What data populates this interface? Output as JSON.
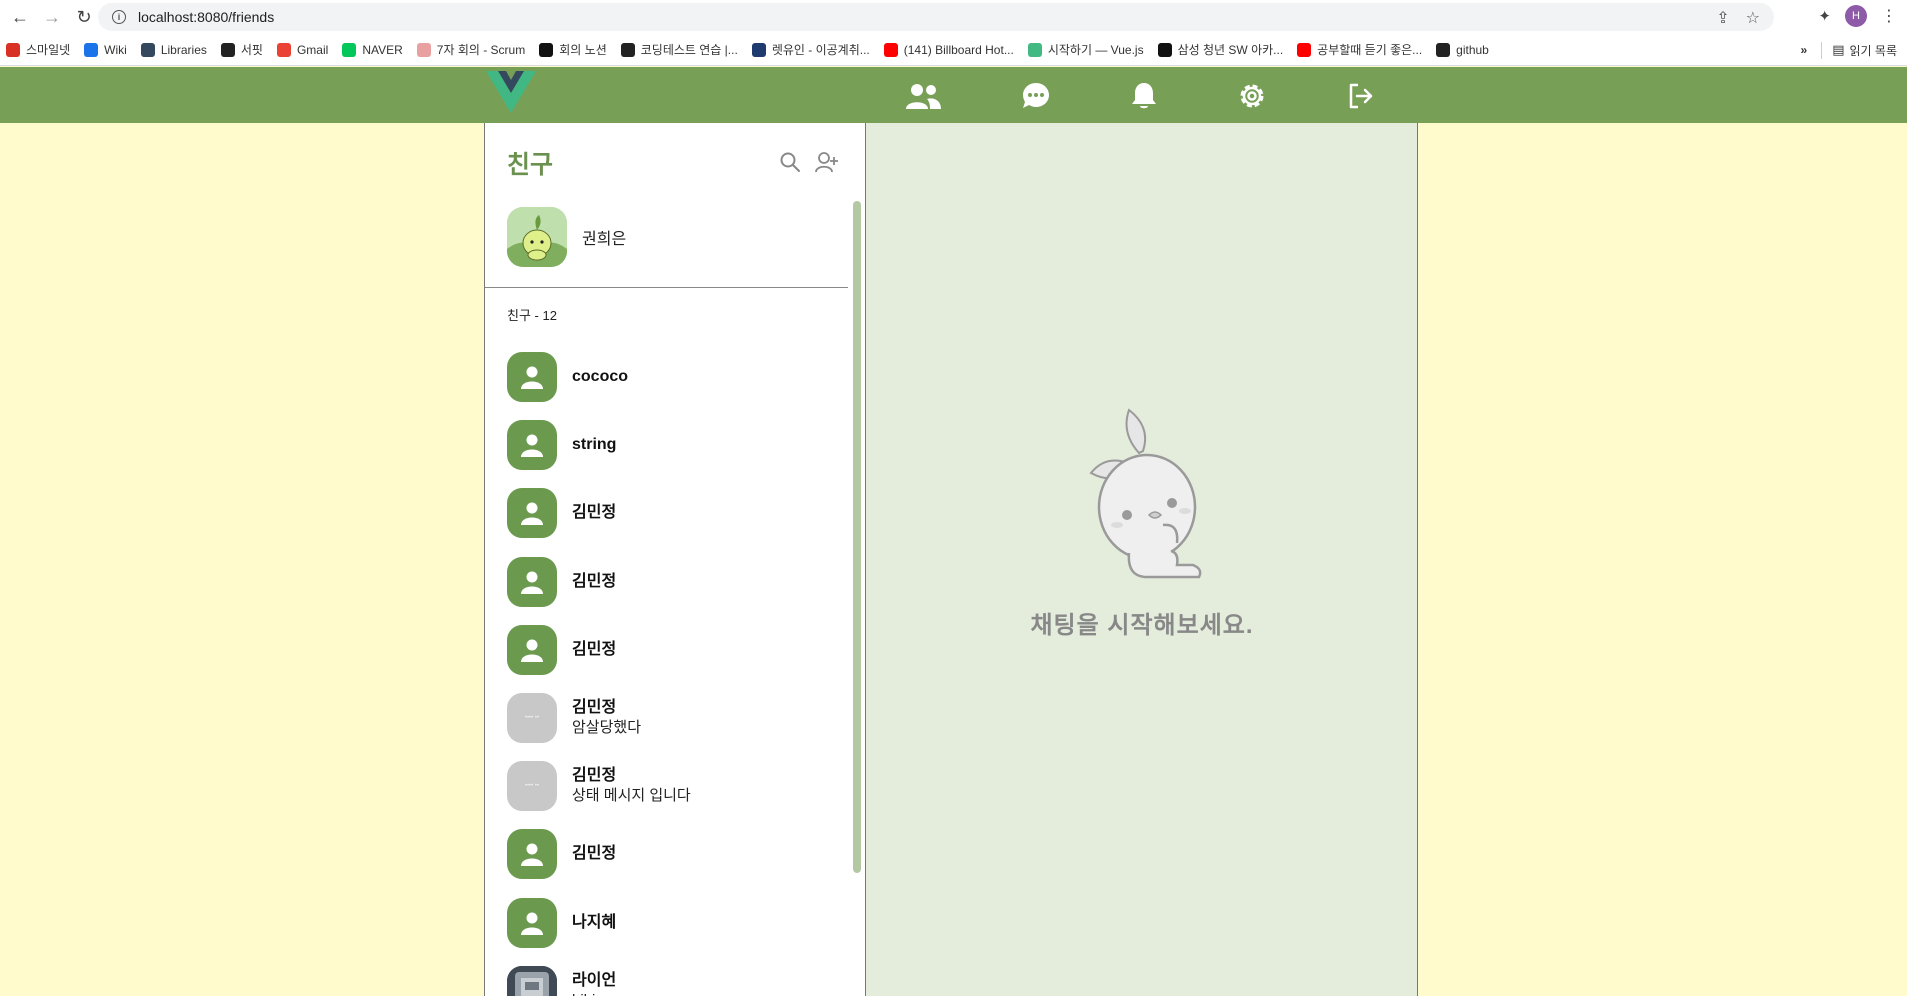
{
  "browser": {
    "url": "localhost:8080/friends",
    "profile_initial": "H",
    "bookmarks": [
      {
        "label": "스마일넷",
        "color": "#d93025"
      },
      {
        "label": "Wiki",
        "color": "#1a73e8"
      },
      {
        "label": "Libraries",
        "color": "#34495e"
      },
      {
        "label": "서핏",
        "color": "#222222"
      },
      {
        "label": "Gmail",
        "color": "#ea4335"
      },
      {
        "label": "NAVER",
        "color": "#03c75a"
      },
      {
        "label": "7자 회의 - Scrum",
        "color": "#e8a0a0"
      },
      {
        "label": "회의 노션",
        "color": "#111111"
      },
      {
        "label": "코딩테스트 연습 |...",
        "color": "#222222"
      },
      {
        "label": "렛유인 - 이공계취...",
        "color": "#1f3a6e"
      },
      {
        "label": "(141) Billboard Hot...",
        "color": "#ff0000"
      },
      {
        "label": "시작하기 — Vue.js",
        "color": "#42b883"
      },
      {
        "label": "삼성 청년 SW 아카...",
        "color": "#111111"
      },
      {
        "label": "공부할때 듣기 좋은...",
        "color": "#ff0000"
      },
      {
        "label": "github",
        "color": "#222222"
      }
    ],
    "reading_list": "읽기 목록"
  },
  "theme": {
    "header": "#779f55",
    "background": "#fffbcc",
    "chat_area": "#e4ecdc",
    "avatar_green": "#6b9a4f",
    "title_green": "#6b9150"
  },
  "header": {
    "icons": [
      "friends-icon",
      "chat-icon",
      "bell-icon",
      "gear-icon",
      "logout-icon"
    ]
  },
  "friends_panel": {
    "title": "친구",
    "me": {
      "name": "권희은"
    },
    "count_label": "친구 - 12",
    "friends": [
      {
        "name": "cococo",
        "status": "",
        "avatar": "default"
      },
      {
        "name": "string",
        "status": "",
        "avatar": "default"
      },
      {
        "name": "김민정",
        "status": "",
        "avatar": "default"
      },
      {
        "name": "김민정",
        "status": "",
        "avatar": "default"
      },
      {
        "name": "김민정",
        "status": "",
        "avatar": "default"
      },
      {
        "name": "김민정",
        "status": "암살당했다",
        "avatar": "gray"
      },
      {
        "name": "김민정",
        "status": "상태 메시지 입니다",
        "avatar": "gray"
      },
      {
        "name": "김민정",
        "status": "",
        "avatar": "default"
      },
      {
        "name": "나지혜",
        "status": "",
        "avatar": "default"
      },
      {
        "name": "라이언",
        "status": "hihi",
        "avatar": "photo"
      }
    ]
  },
  "chat_panel": {
    "empty_message": "채팅을 시작해보세요."
  }
}
